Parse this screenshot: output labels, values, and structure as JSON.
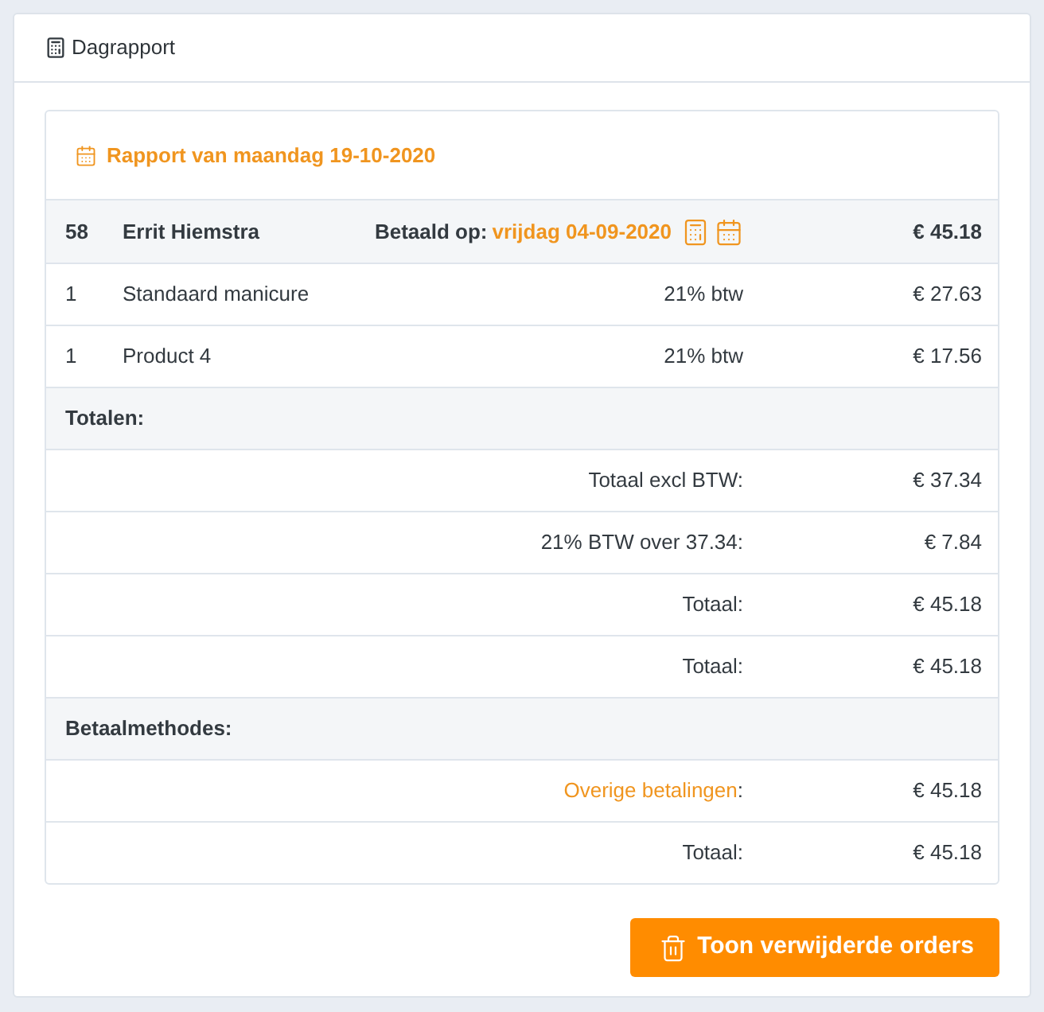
{
  "panel": {
    "title": "Dagrapport"
  },
  "report": {
    "heading": "Rapport van maandag 19-10-2020",
    "order": {
      "number": "58",
      "customer": "Errit Hiemstra",
      "paid_label": "Betaald op:",
      "paid_date": "vrijdag 04-09-2020",
      "total": "€ 45.18"
    },
    "lines": [
      {
        "quantity": "1",
        "product": "Standaard manicure",
        "tax": "21% btw",
        "amount": "€ 27.63"
      },
      {
        "quantity": "1",
        "product": "Product 4",
        "tax": "21% btw",
        "amount": "€ 17.56"
      }
    ],
    "sections": [
      {
        "title": "Totalen:",
        "rows": [
          {
            "kind": "plain",
            "label": "Totaal excl BTW:",
            "amount": "€ 37.34"
          },
          {
            "kind": "plain",
            "label": "21% BTW over 37.34:",
            "amount": "€ 7.84"
          },
          {
            "kind": "plain",
            "label": "Totaal:",
            "amount": "€ 45.18"
          },
          {
            "kind": "plain",
            "label": "Totaal:",
            "amount": "€ 45.18"
          }
        ]
      },
      {
        "title": "Betaalmethodes:",
        "rows": [
          {
            "kind": "link",
            "label": "Overige betalingen",
            "suffix": ":",
            "amount": "€ 45.18"
          },
          {
            "kind": "plain",
            "label": "Totaal:",
            "amount": "€ 45.18"
          }
        ]
      }
    ]
  },
  "actions": [
    {
      "label": "Toon verwijderde orders"
    }
  ]
}
